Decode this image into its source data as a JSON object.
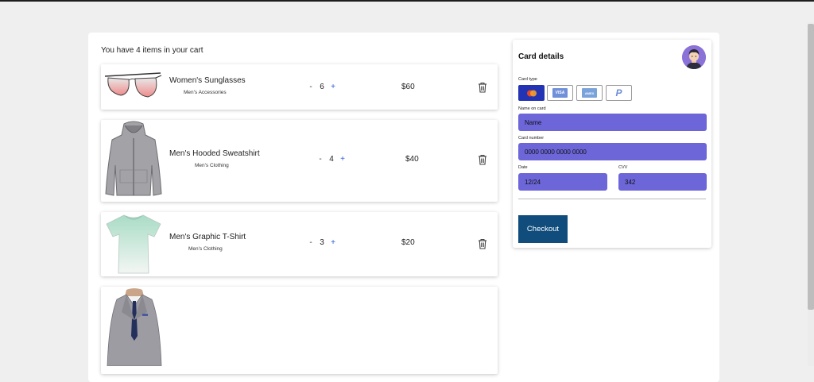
{
  "cart": {
    "title": "You have 4 items in your cart",
    "items": [
      {
        "name": "Women's Sunglasses",
        "category": "Men's Accessories",
        "quantity": "6",
        "price": "$60"
      },
      {
        "name": "Men's Hooded Sweatshirt",
        "category": "Men's Clothing",
        "quantity": "4",
        "price": "$40"
      },
      {
        "name": "Men's Graphic T-Shirt",
        "category": "Men's Clothing",
        "quantity": "3",
        "price": "$20"
      },
      {
        "name": "",
        "category": "",
        "quantity": "",
        "price": ""
      }
    ],
    "minus_label": "-",
    "plus_label": "+"
  },
  "payment": {
    "title": "Card details",
    "card_type_label": "Card type",
    "card_types": [
      "mastercard",
      "visa",
      "amex",
      "paypal"
    ],
    "active_card_type": "mastercard",
    "name_label": "Name on card",
    "name_placeholder": "Name",
    "number_label": "Card number",
    "number_placeholder": "0000 0000 0000 0000",
    "date_label": "Date",
    "date_placeholder": "12/24",
    "cvv_label": "CVV",
    "cvv_placeholder": "342",
    "checkout_label": "Checkout"
  },
  "icons": {
    "visa_text": "VISA",
    "amex_text": "AMEX",
    "paypal_text": "P"
  },
  "colors": {
    "field_bg": "#6c66d8",
    "checkout_bg": "#104d7c",
    "active_card_bg": "#2233b3",
    "plus": "#2a5bd7"
  }
}
